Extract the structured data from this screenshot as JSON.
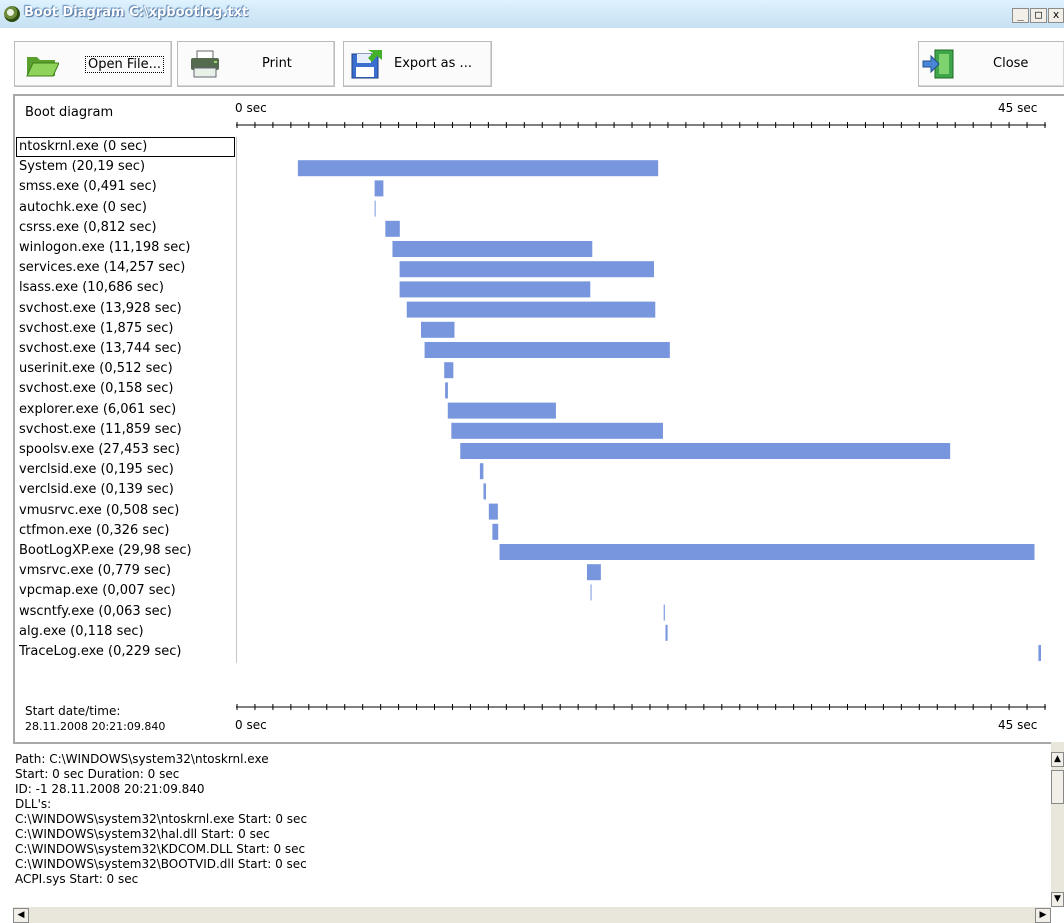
{
  "window": {
    "title": "Boot Diagram C:\\xpbootlog.txt",
    "controls": {
      "minimize": "_",
      "restore": "□",
      "close": "x"
    }
  },
  "toolbar": {
    "open_file": "Open File...",
    "print": "Print",
    "export": "Export as ...",
    "close": "Close"
  },
  "chart": {
    "header_label": "Boot diagram",
    "axis_start": "0 sec",
    "axis_end": "45 sec",
    "axis_max_sec": 45,
    "start_label": "Start date/time:",
    "start_value": "28.11.2008 20:21:09.840",
    "bar_color": "#7896dd",
    "processes": [
      {
        "label": "ntoskrnl.exe (0 sec)",
        "start": 0,
        "duration": 0
      },
      {
        "label": "System (20,19 sec)",
        "start": 3.3,
        "duration": 20.19
      },
      {
        "label": "smss.exe (0,491 sec)",
        "start": 7.6,
        "duration": 0.491
      },
      {
        "label": "autochk.exe (0 sec)",
        "start": 7.6,
        "duration": 0.05
      },
      {
        "label": "csrss.exe (0,812 sec)",
        "start": 8.2,
        "duration": 0.812
      },
      {
        "label": "winlogon.exe (11,198 sec)",
        "start": 8.6,
        "duration": 11.198
      },
      {
        "label": "services.exe (14,257 sec)",
        "start": 9.0,
        "duration": 14.257
      },
      {
        "label": "lsass.exe (10,686 sec)",
        "start": 9.0,
        "duration": 10.686
      },
      {
        "label": "svchost.exe (13,928 sec)",
        "start": 9.4,
        "duration": 13.928
      },
      {
        "label": "svchost.exe (1,875 sec)",
        "start": 10.2,
        "duration": 1.875
      },
      {
        "label": "svchost.exe (13,744 sec)",
        "start": 10.4,
        "duration": 13.744
      },
      {
        "label": "userinit.exe (0,512 sec)",
        "start": 11.5,
        "duration": 0.512
      },
      {
        "label": "svchost.exe (0,158 sec)",
        "start": 11.55,
        "duration": 0.158
      },
      {
        "label": "explorer.exe (6,061 sec)",
        "start": 11.7,
        "duration": 6.061
      },
      {
        "label": "svchost.exe (11,859 sec)",
        "start": 11.9,
        "duration": 11.859
      },
      {
        "label": "spoolsv.exe (27,453 sec)",
        "start": 12.4,
        "duration": 27.453
      },
      {
        "label": "verclsid.exe (0,195 sec)",
        "start": 13.5,
        "duration": 0.195
      },
      {
        "label": "verclsid.exe (0,139 sec)",
        "start": 13.7,
        "duration": 0.139
      },
      {
        "label": "vmusrvc.exe (0,508 sec)",
        "start": 14.0,
        "duration": 0.508
      },
      {
        "label": "ctfmon.exe (0,326 sec)",
        "start": 14.2,
        "duration": 0.326
      },
      {
        "label": "BootLogXP.exe (29,98 sec)",
        "start": 14.6,
        "duration": 29.98
      },
      {
        "label": "vmsrvc.exe (0,779 sec)",
        "start": 19.5,
        "duration": 0.779
      },
      {
        "label": "vpcmap.exe (0,007 sec)",
        "start": 19.7,
        "duration": 0.05
      },
      {
        "label": "wscntfy.exe (0,063 sec)",
        "start": 23.8,
        "duration": 0.063
      },
      {
        "label": "alg.exe (0,118 sec)",
        "start": 23.9,
        "duration": 0.118
      },
      {
        "label": "TraceLog.exe (0,229 sec)",
        "start": 44.8,
        "duration": 0.229
      }
    ]
  },
  "details": {
    "lines": [
      "Path: C:\\WINDOWS\\system32\\ntoskrnl.exe",
      "Start: 0 sec Duration: 0 sec",
      "ID: -1  28.11.2008  20:21:09.840",
      "DLL's:",
      "C:\\WINDOWS\\system32\\ntoskrnl.exe Start: 0 sec",
      "C:\\WINDOWS\\system32\\hal.dll Start: 0 sec",
      "C:\\WINDOWS\\system32\\KDCOM.DLL Start: 0 sec",
      "C:\\WINDOWS\\system32\\BOOTVID.dll Start: 0 sec",
      "ACPI.sys Start: 0 sec"
    ]
  }
}
